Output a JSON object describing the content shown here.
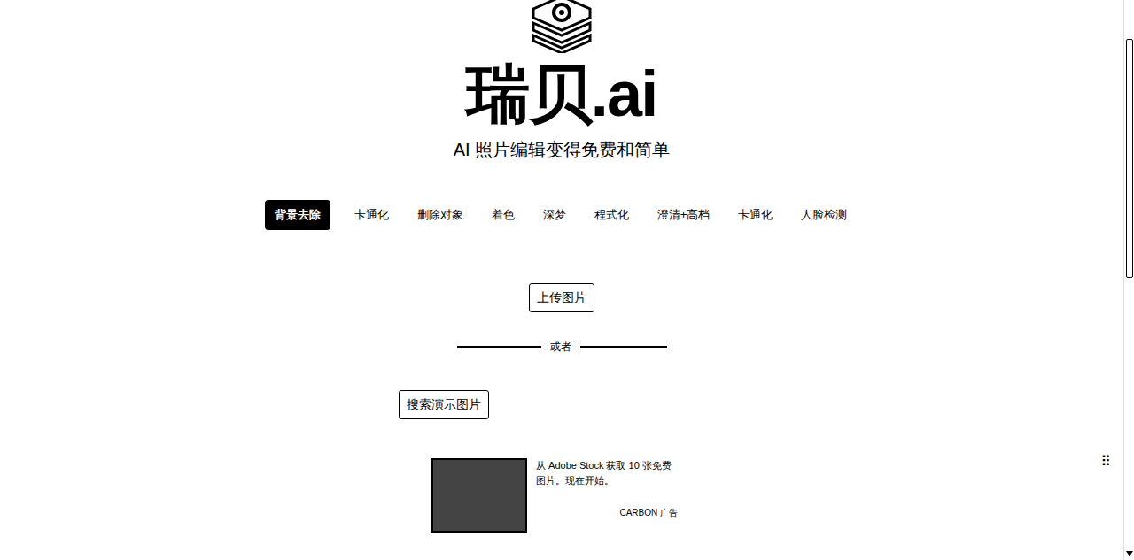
{
  "logo": {
    "title": "瑞贝.ai",
    "subtitle": "AI 照片编辑变得免费和简单"
  },
  "tabs": [
    {
      "label": "背景去除",
      "selected": true
    },
    {
      "label": "卡通化",
      "selected": false
    },
    {
      "label": "删除对象",
      "selected": false
    },
    {
      "label": "着色",
      "selected": false
    },
    {
      "label": "深梦",
      "selected": false
    },
    {
      "label": "程式化",
      "selected": false
    },
    {
      "label": "澄清+高档",
      "selected": false
    },
    {
      "label": "卡通化",
      "selected": false
    },
    {
      "label": "人脸检测",
      "selected": false
    }
  ],
  "upload_button": "上传图片",
  "divider": "或者",
  "demo_button": "搜索演示图片",
  "ad": {
    "text": "从 Adobe Stock 获取 10 张免费图片。现在开始。",
    "label": "CARBON 广告"
  },
  "menu_icon": "⠿"
}
